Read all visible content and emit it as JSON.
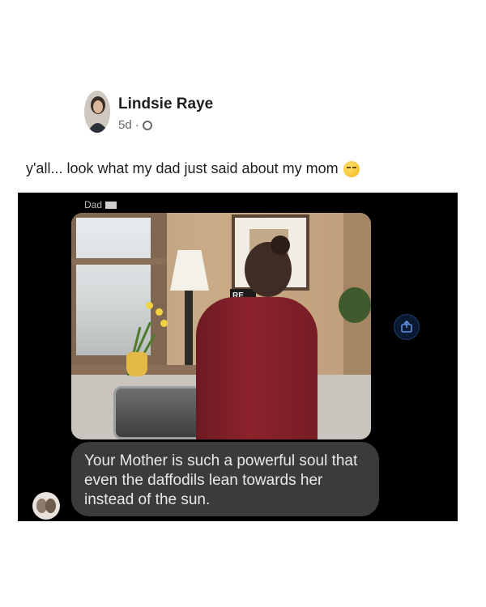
{
  "post": {
    "author": "Lindsie Raye",
    "age": "5d",
    "separator": "·",
    "privacy_icon": "globe-icon",
    "caption": "y'all... look what my dad just said about my mom",
    "caption_emoji": "crying-laughing-emoji"
  },
  "message_screenshot": {
    "sender_label": "Dad",
    "sign_text": "RE",
    "message": "Your Mother is such a powerful soul that even the daffodils lean towards her instead of the sun.",
    "share_icon": "share-icon"
  }
}
